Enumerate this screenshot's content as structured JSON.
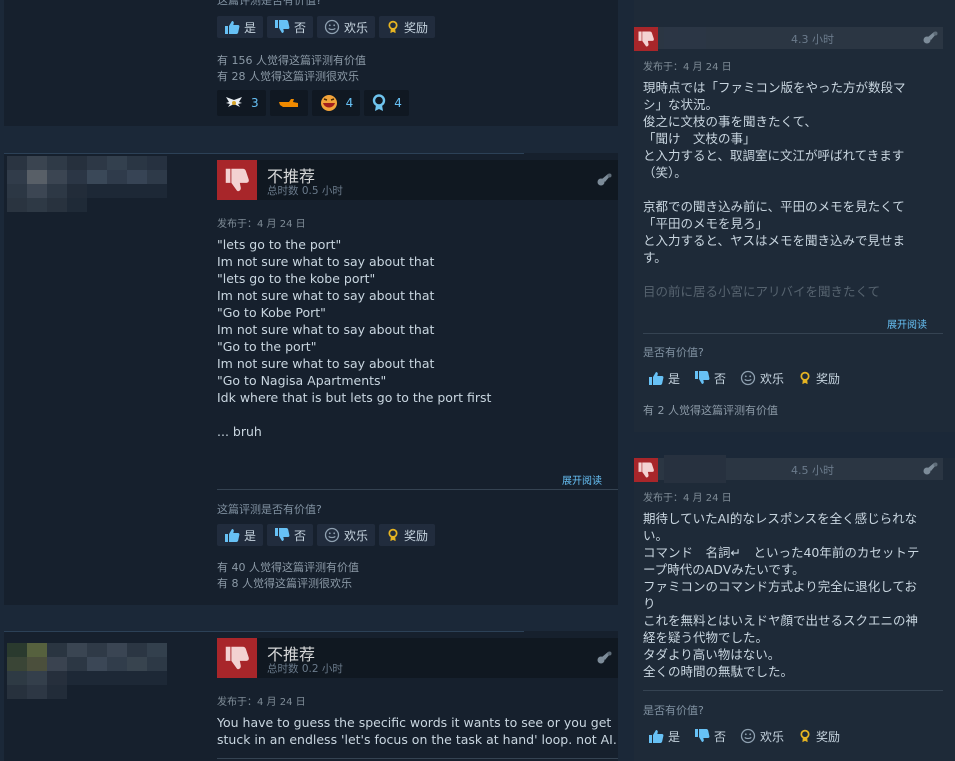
{
  "colors": {
    "page_bg": "#1b2838",
    "panel_bg": "#16202d",
    "thumb_down": "#a8262a",
    "link": "#67c1f5"
  },
  "vote_labels": {
    "yes": "是",
    "no": "否",
    "funny": "欢乐",
    "award": "奖励"
  },
  "top_review": {
    "cut_question": "这篇评测是否有价值?",
    "helpful_text": "有 156 人觉得这篇评测有价值",
    "funny_text": "有 28 人觉得这篇评测很欢乐",
    "awards": [
      {
        "icon": "winged-award-icon",
        "count": "3"
      },
      {
        "icon": "pointing-hand-award-icon",
        "count": ""
      },
      {
        "icon": "laughing-face-award-icon",
        "count": "4"
      },
      {
        "icon": "ribbon-award-icon",
        "count": "4"
      }
    ]
  },
  "left_reviews": [
    {
      "recommendation": "不推荐",
      "hours": "总时数 0.5 小时",
      "posted": "发布于：4 月 24 日",
      "body": "\"lets go to the port\"\nIm not sure what to say about that\n\"lets go to the kobe port\"\nIm not sure what to say about that\n\"Go to Kobe Port\"\nIm not sure what to say about that\n\"Go to the port\"\nIm not sure what to say about that\n\"Go to Nagisa Apartments\"\nIdk where that is but lets go to the port first\n\n... bruh",
      "read_more": "展开阅读",
      "question": "这篇评测是否有价值?",
      "helpful_text": "有 40 人觉得这篇评测有价值",
      "funny_text": "有 8 人觉得这篇评测很欢乐"
    },
    {
      "recommendation": "不推荐",
      "hours": "总时数 0.2 小时",
      "posted": "发布于：4 月 24 日",
      "body": "You have to guess the specific words it wants to see or you get\nstuck in an endless 'let's focus on the task at hand' loop. not AI."
    }
  ],
  "right_reviews": [
    {
      "hours": "4.3 小时",
      "posted": "发布于：4 月 24 日",
      "body": "現時点では「ファミコン版をやった方が数段マ\nシ」な状況。\n俊之に文枝の事を聞きたくて、\n「聞け　文枝の事」\nと入力すると、取調室に文江が呼ばれてきます\n（笑）。\n\n京都での聞き込み前に、平田のメモを見たくて\n「平田のメモを見ろ」\nと入力すると、ヤスはメモを聞き込みで見せま\nす。",
      "faded": "目の前に居る小宮にアリバイを聞きたくて",
      "read_more": "展开阅读",
      "question": "是否有价值?",
      "helpful_text": "有 2 人觉得这篇评测有价值"
    },
    {
      "hours": "4.5 小时",
      "posted": "发布于：4 月 24 日",
      "body": "期待していたAI的なレスポンスを全く感じられな\nい。\nコマンド　名詞↵　といった40年前のカセットテ\nープ時代のADVみたいです。\nファミコンのコマンド方式より完全に退化してお\nり\nこれを無料とはいえドヤ顔で出せるスクエニの神\n経を疑う代物でした。\nタダより高い物はない。\n全くの時間の無駄でした。",
      "question": "是否有价值?"
    }
  ]
}
